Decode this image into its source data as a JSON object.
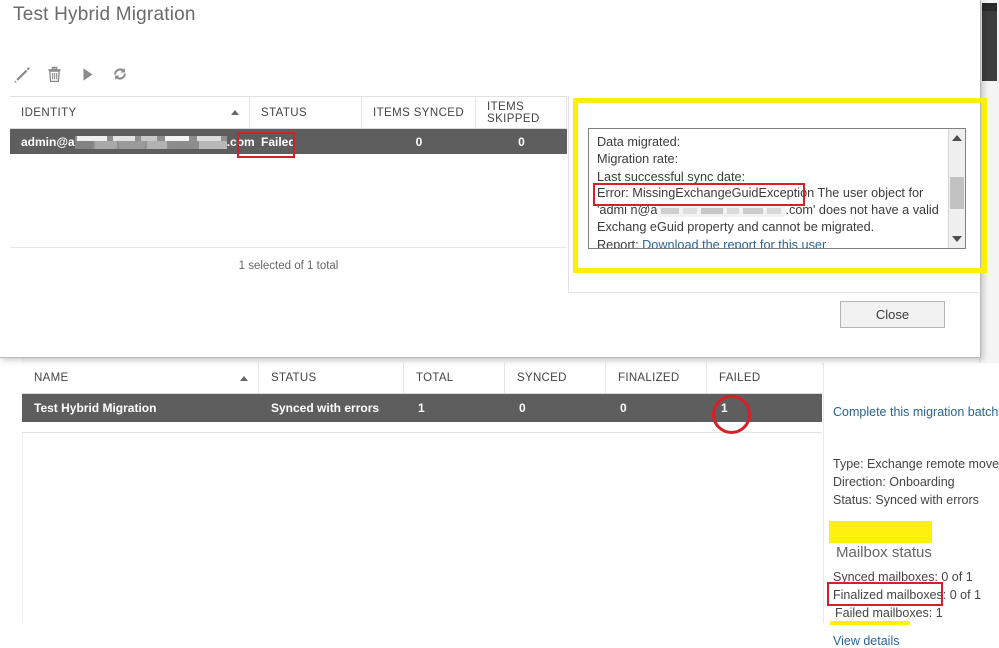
{
  "background_page": {
    "grid": {
      "columns": [
        "NAME",
        "STATUS",
        "TOTAL",
        "SYNCED",
        "FINALIZED",
        "FAILED"
      ],
      "sorted_column": "NAME",
      "rows": [
        {
          "name": "Test Hybrid Migration",
          "status": "Synced with errors",
          "total": "1",
          "synced": "0",
          "finalized": "0",
          "failed": "1"
        }
      ]
    },
    "details_pane": {
      "complete_batch_link": "Complete this migration batch",
      "type": "Type: Exchange remote move",
      "direction": "Direction: Onboarding",
      "status": "Status: Synced with errors",
      "mailbox_status_heading": "Mailbox status",
      "synced_mailboxes": "Synced mailboxes: 0 of 1",
      "finalized_mailboxes": "Finalized mailboxes: 0 of 1",
      "failed_mailboxes": "Failed mailboxes: 1",
      "view_details_link": "View details"
    }
  },
  "dialog": {
    "title": "Test Hybrid Migration",
    "toolbar": [
      {
        "name": "edit-icon",
        "label": "Edit"
      },
      {
        "name": "delete-icon",
        "label": "Delete"
      },
      {
        "name": "play-icon",
        "label": "Start"
      },
      {
        "name": "refresh-icon",
        "label": "Refresh"
      }
    ],
    "grid": {
      "columns": [
        "IDENTITY",
        "STATUS",
        "ITEMS SYNCED",
        "ITEMS SKIPPED"
      ],
      "sorted_column": "IDENTITY",
      "rows": [
        {
          "identity_prefix": "admin@a",
          "identity_suffix": ".com",
          "status": "Failed",
          "items_synced": "0",
          "items_skipped": "0"
        }
      ],
      "selection_summary": "1 selected of 1 total"
    },
    "detail_pane": {
      "lines": [
        "Data migrated:",
        "Migration rate:",
        "Last successful sync date:"
      ],
      "error_label": "Error: MissingExchangeGuidException",
      "error_text_before_redaction": " The user object for 'admi n@a",
      "error_text_after_redaction": ".com' does not have a valid Exchang eGuid property and cannot be migrated.",
      "report_label": "Report: ",
      "report_link": "Download the report for this user"
    },
    "close_button": "Close"
  },
  "colors": {
    "annotation_red": "#d81f26",
    "annotation_yellow": "#ffef00",
    "selected_row": "#5e5e5e",
    "link_blue": "#2a6496"
  }
}
